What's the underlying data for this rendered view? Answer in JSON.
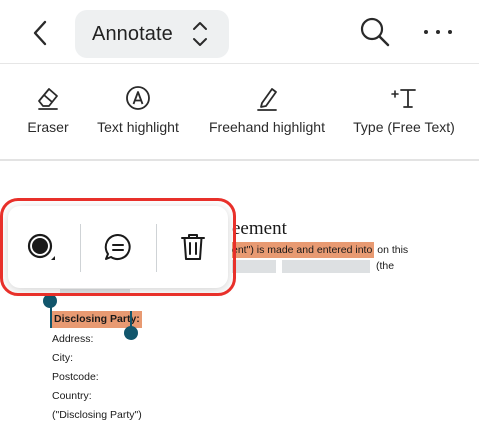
{
  "header": {
    "back_icon": "chevron-left-icon",
    "mode_label": "Annotate",
    "mode_icon": "chevron-up-down-icon",
    "search_icon": "search-icon",
    "more_icon": "more-horizontal-icon"
  },
  "tools": [
    {
      "label": "Eraser",
      "icon": "eraser-icon"
    },
    {
      "label": "Text highlight",
      "icon": "text-highlight-icon"
    },
    {
      "label": "Freehand highlight",
      "icon": "freehand-highlight-icon"
    },
    {
      "label": "Type (Free Text)",
      "icon": "type-free-text-icon"
    }
  ],
  "document": {
    "heading": "eement",
    "line1_highlight": "ent\") is made and entered into",
    "line1_rest": " on this",
    "line2_end": "(the",
    "selected_text": "Disclosing Party:",
    "fields": [
      "Address:",
      "City:",
      "Postcode:",
      "Country:",
      "(\"Disclosing Party\")"
    ]
  },
  "popup": {
    "buttons": [
      {
        "name": "color-picker",
        "icon": "color-circle-icon"
      },
      {
        "name": "comment",
        "icon": "comment-icon"
      },
      {
        "name": "delete",
        "icon": "trash-icon"
      }
    ]
  },
  "colors": {
    "highlight": "#e89a72",
    "selection_handle": "#11566c",
    "callout_outline": "#e8302a",
    "pill_background": "#eef0f1"
  }
}
